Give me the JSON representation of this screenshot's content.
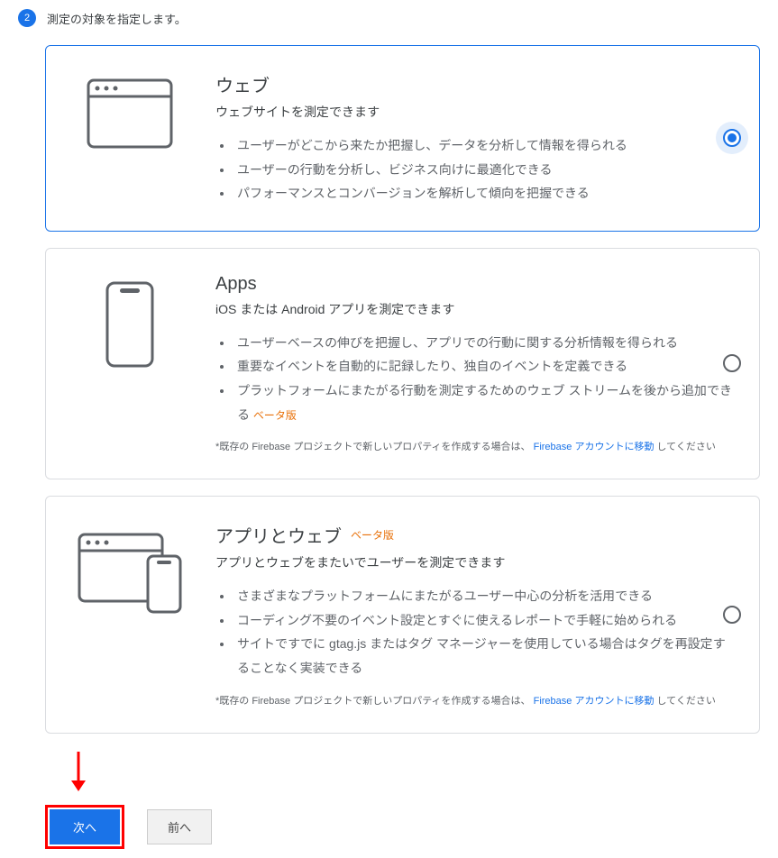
{
  "step": {
    "number": "2",
    "title": "測定の対象を指定します。"
  },
  "options": {
    "web": {
      "title": "ウェブ",
      "subtitle": "ウェブサイトを測定できます",
      "bullets": [
        "ユーザーがどこから来たか把握し、データを分析して情報を得られる",
        "ユーザーの行動を分析し、ビジネス向けに最適化できる",
        "パフォーマンスとコンバージョンを解析して傾向を把握できる"
      ]
    },
    "apps": {
      "title": "Apps",
      "subtitle": "iOS または Android アプリを測定できます",
      "bullets": [
        "ユーザーベースの伸びを把握し、アプリでの行動に関する分析情報を得られる",
        "重要なイベントを自動的に記録したり、独自のイベントを定義できる"
      ],
      "bullet3_part1": "プラットフォームにまたがる行動を測定するためのウェブ ストリームを後から追加できる",
      "beta_label": "ベータ版",
      "footnote_prefix": "*既存の Firebase プロジェクトで新しいプロパティを作成する場合は、",
      "footnote_link": "Firebase アカウントに移動",
      "footnote_suffix": "してください"
    },
    "both": {
      "title": "アプリとウェブ",
      "beta_label": "ベータ版",
      "subtitle": "アプリとウェブをまたいでユーザーを測定できます",
      "bullets": [
        "さまざまなプラットフォームにまたがるユーザー中心の分析を活用できる",
        "コーディング不要のイベント設定とすぐに使えるレポートで手軽に始められる",
        "サイトですでに gtag.js またはタグ マネージャーを使用している場合はタグを再設定することなく実装できる"
      ],
      "footnote_prefix": "*既存の Firebase プロジェクトで新しいプロパティを作成する場合は、",
      "footnote_link": "Firebase アカウントに移動",
      "footnote_suffix": "してください"
    }
  },
  "buttons": {
    "next": "次へ",
    "prev": "前へ"
  }
}
